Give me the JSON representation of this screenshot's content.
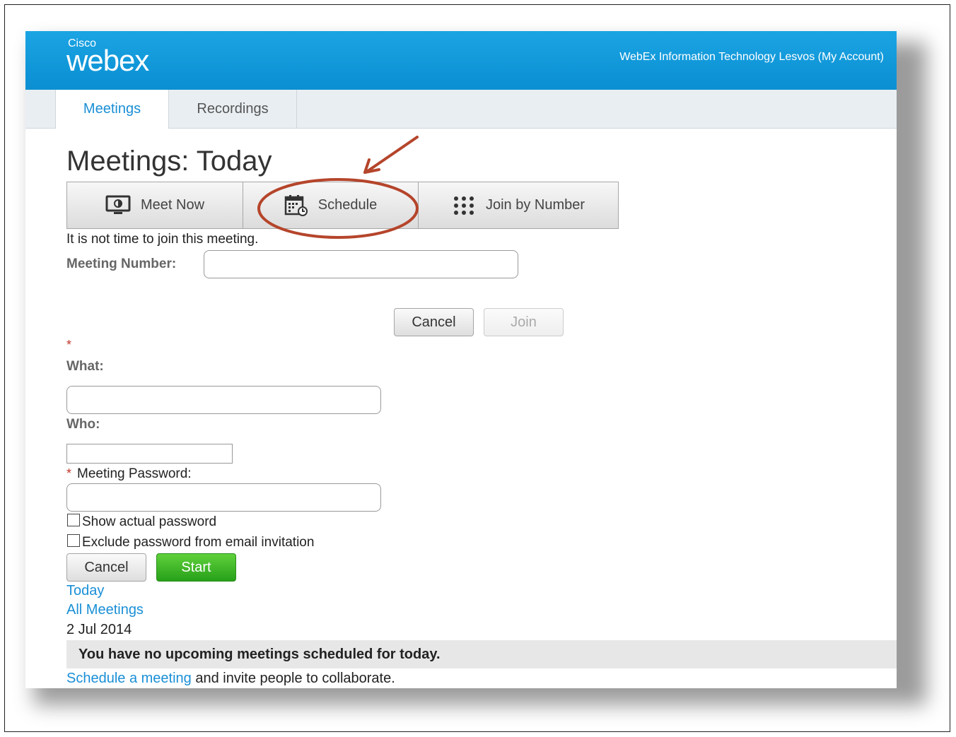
{
  "header": {
    "logo_cisco": "Cisco",
    "logo_webex": "webex",
    "account": "WebEx Information Technology Lesvos (My Account)"
  },
  "tabs": [
    {
      "label": "Meetings",
      "active": true
    },
    {
      "label": "Recordings",
      "active": false
    }
  ],
  "page_title": "Meetings: Today",
  "actions": {
    "meet_now": "Meet Now",
    "schedule": "Schedule",
    "join_by_number": "Join by Number"
  },
  "join": {
    "message": "It is not time to join this meeting.",
    "meeting_number_label": "Meeting Number:",
    "meeting_number_value": "",
    "cancel": "Cancel",
    "join": "Join"
  },
  "meet_form": {
    "required_marker": "*",
    "what_label": "What:",
    "what_value": "",
    "who_label": "Who:",
    "who_value": "",
    "password_label": "Meeting Password:",
    "password_value": "",
    "show_password_label": "Show actual password",
    "show_password_checked": false,
    "exclude_password_label": "Exclude password from email invitation",
    "exclude_password_checked": false,
    "cancel": "Cancel",
    "start": "Start"
  },
  "nav_links": {
    "today": "Today",
    "all_meetings": "All Meetings"
  },
  "date": "2 Jul 2014",
  "notice": "You have no upcoming meetings scheduled for today.",
  "footer": {
    "link": "Schedule a meeting",
    "rest": " and invite people to collaborate."
  },
  "colors": {
    "header_blue": "#0a8fd2",
    "link_blue": "#1a8fd6",
    "start_green": "#27a019",
    "annotation_red": "#b5452b"
  }
}
